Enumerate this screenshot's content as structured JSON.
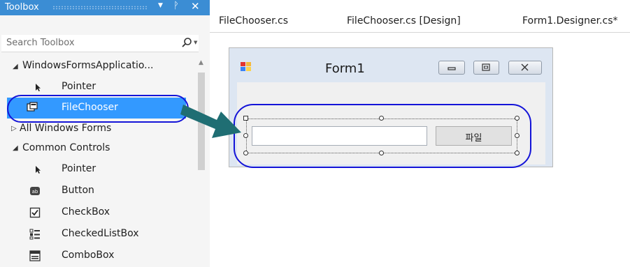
{
  "toolbox": {
    "title": "Toolbox",
    "dropdown_icon": "dropdown-arrow-icon",
    "pin_icon": "pin-icon",
    "close_icon": "close-icon",
    "search": {
      "placeholder": "Search Toolbox",
      "icon": "search-icon"
    },
    "items": [
      {
        "label": "WindowsFormsApplicatio...",
        "type": "group",
        "expanded": true
      },
      {
        "label": "Pointer",
        "icon": "pointer-icon"
      },
      {
        "label": "FileChooser",
        "icon": "user-control-icon",
        "selected": true
      },
      {
        "label": "All Windows Forms",
        "type": "group",
        "expanded": false
      },
      {
        "label": "Common Controls",
        "type": "group",
        "expanded": true
      },
      {
        "label": "Pointer",
        "icon": "pointer-icon"
      },
      {
        "label": "Button",
        "icon": "button-icon"
      },
      {
        "label": "CheckBox",
        "icon": "checkbox-icon"
      },
      {
        "label": "CheckedListBox",
        "icon": "checked-list-icon"
      },
      {
        "label": "ComboBox",
        "icon": "combobox-icon"
      }
    ]
  },
  "tabs": [
    {
      "label": "FileChooser.cs"
    },
    {
      "label": "FileChooser.cs [Design]"
    },
    {
      "label": "Form1.Designer.cs*"
    }
  ],
  "designer": {
    "form_title": "Form1",
    "file_button_label": "파일",
    "textbox_value": ""
  },
  "colors": {
    "accent": "#3b8dd4",
    "selection": "#3399ff",
    "callout": "#1414d8",
    "arrow": "#1f6e73"
  }
}
